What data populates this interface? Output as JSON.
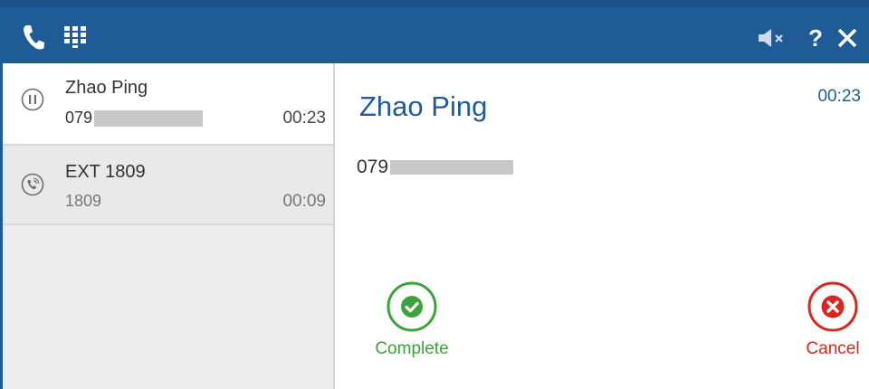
{
  "titlebar": {
    "icons": [
      "phone-icon",
      "dialpad-icon",
      "speaker-mute-icon",
      "help-icon",
      "close-icon"
    ],
    "help_label": "?"
  },
  "calls": [
    {
      "name": "Zhao Ping",
      "number_prefix": "079",
      "number_redacted": true,
      "time": "00:23",
      "status_icon": "pause-icon",
      "active": true
    },
    {
      "name": "EXT 1809",
      "number": "1809",
      "time": "00:09",
      "status_icon": "call-in-progress-icon",
      "active": false
    }
  ],
  "current_call": {
    "name": "Zhao Ping",
    "number_prefix": "079",
    "number_redacted": true,
    "time": "00:23"
  },
  "actions": {
    "complete_label": "Complete",
    "cancel_label": "Cancel"
  },
  "colors": {
    "titlebar": "#1f5c97",
    "accent": "#1f5c97",
    "complete": "#3ea33a",
    "cancel": "#d7271f",
    "sidebar": "#ececec"
  }
}
